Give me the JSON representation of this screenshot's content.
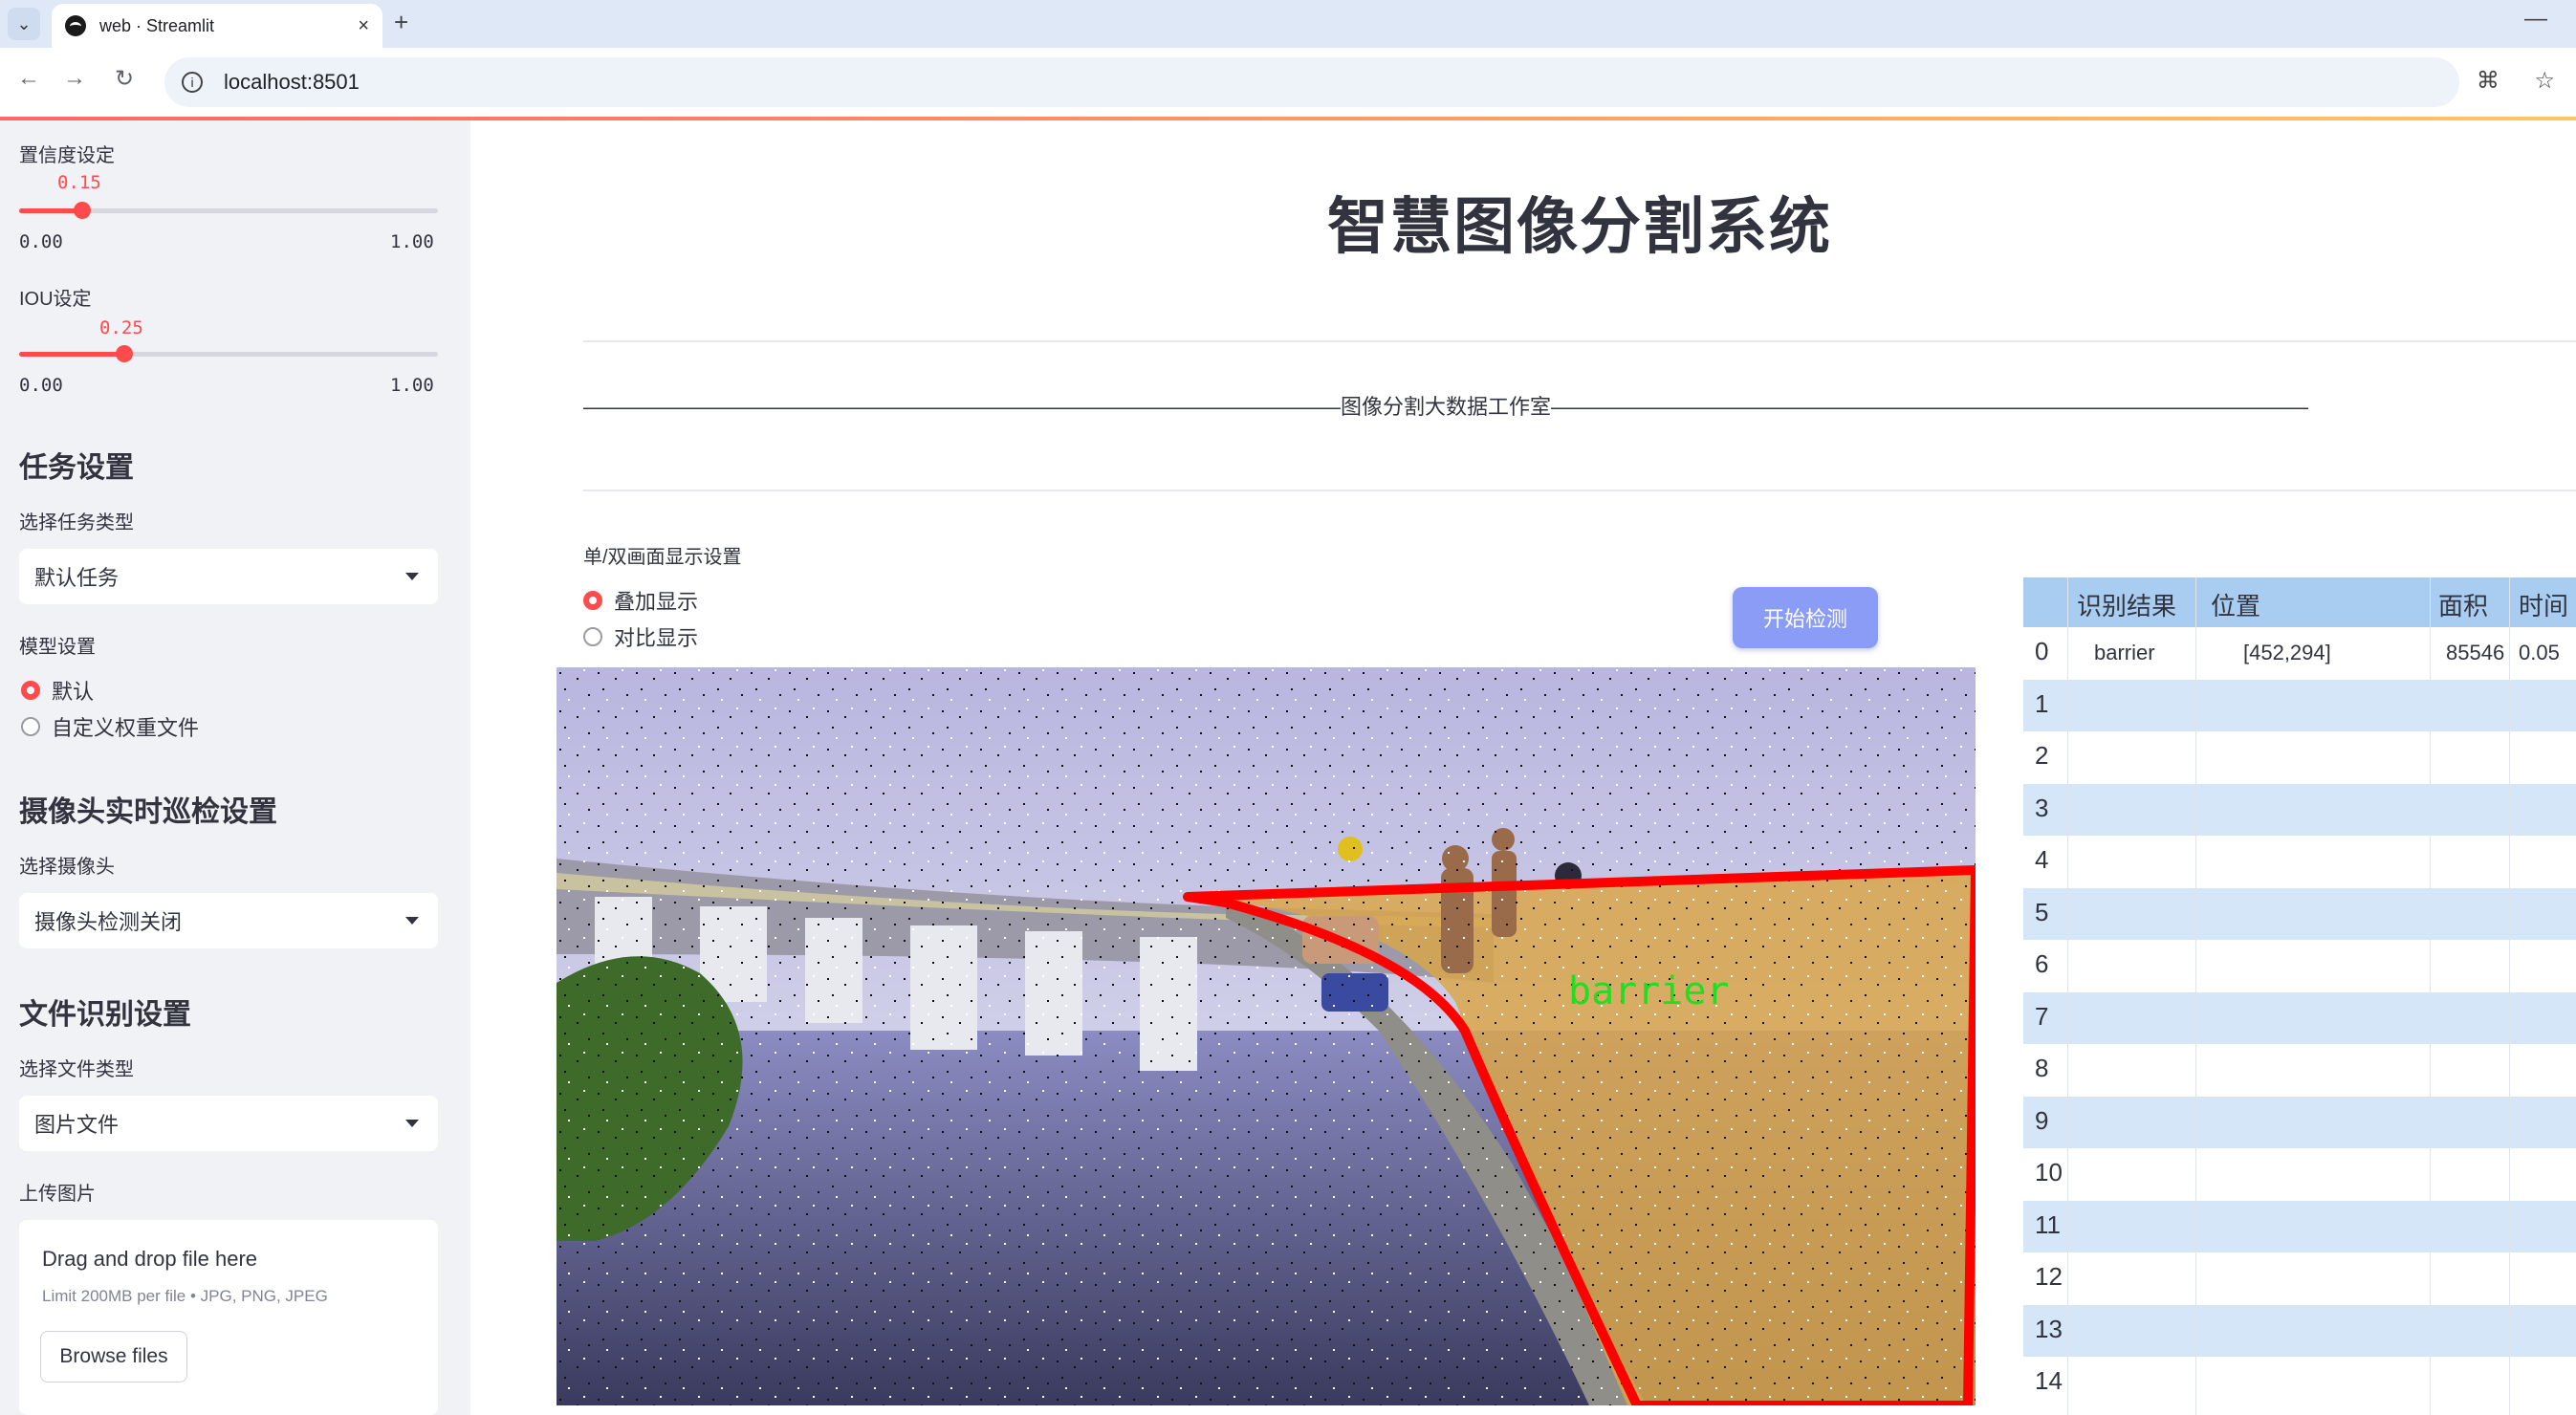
{
  "browser": {
    "tab_title": "web · Streamlit",
    "close_glyph": "×",
    "new_tab_glyph": "+",
    "minimize_glyph": "—",
    "url": "localhost:8501",
    "icons": [
      "tab-menu-icon",
      "back-icon",
      "forward-icon",
      "reload-icon",
      "site-info-icon",
      "translate-icon",
      "bookmark-star-icon"
    ]
  },
  "sidebar": {
    "confidence": {
      "label": "置信度设定",
      "value": "0.15",
      "min": "0.00",
      "max": "1.00",
      "fraction": 0.15
    },
    "iou": {
      "label": "IOU设定",
      "value": "0.25",
      "min": "0.00",
      "max": "1.00",
      "fraction": 0.25
    },
    "task": {
      "heading": "任务设置",
      "label": "选择任务类型",
      "selected": "默认任务"
    },
    "model": {
      "label": "模型设置",
      "options": [
        "默认",
        "自定义权重文件"
      ],
      "selected_index": 0
    },
    "camera": {
      "heading": "摄像头实时巡检设置",
      "label": "选择摄像头",
      "selected": "摄像头检测关闭"
    },
    "file": {
      "heading": "文件识别设置",
      "label": "选择文件类型",
      "selected": "图片文件"
    },
    "upload": {
      "label": "上传图片",
      "drop_text": "Drag and drop file here",
      "limit_text": "Limit 200MB per file • JPG, PNG, JPEG",
      "browse_label": "Browse files"
    }
  },
  "main": {
    "title": "智慧图像分割系统",
    "subtitle_line": "————————————————————————————————————图像分割大数据工作室————————————————————————————————————",
    "display_label": "单/双画面显示设置",
    "display_options": [
      "叠加显示",
      "对比显示"
    ],
    "display_selected_index": 0,
    "detect_button": "开始检测",
    "detection_label": "barrier"
  },
  "colors": {
    "accent": "#ff4b4b",
    "sidebar_bg": "#f0f2f6",
    "button": "#8a9cf5",
    "table_header": "#a9cdf0",
    "table_alt": "#d4e6f8",
    "mask_outline": "#ff0000",
    "label_green": "#22dd22"
  },
  "table": {
    "columns": [
      "识别结果",
      "位置",
      "面积",
      "时间"
    ],
    "rows": [
      {
        "idx": "0",
        "result": "barrier",
        "pos": "[452,294]",
        "area": "85546",
        "time": "0.05"
      },
      {
        "idx": "1",
        "result": "",
        "pos": "",
        "area": "",
        "time": ""
      },
      {
        "idx": "2",
        "result": "",
        "pos": "",
        "area": "",
        "time": ""
      },
      {
        "idx": "3",
        "result": "",
        "pos": "",
        "area": "",
        "time": ""
      },
      {
        "idx": "4",
        "result": "",
        "pos": "",
        "area": "",
        "time": ""
      },
      {
        "idx": "5",
        "result": "",
        "pos": "",
        "area": "",
        "time": ""
      },
      {
        "idx": "6",
        "result": "",
        "pos": "",
        "area": "",
        "time": ""
      },
      {
        "idx": "7",
        "result": "",
        "pos": "",
        "area": "",
        "time": ""
      },
      {
        "idx": "8",
        "result": "",
        "pos": "",
        "area": "",
        "time": ""
      },
      {
        "idx": "9",
        "result": "",
        "pos": "",
        "area": "",
        "time": ""
      },
      {
        "idx": "10",
        "result": "",
        "pos": "",
        "area": "",
        "time": ""
      },
      {
        "idx": "11",
        "result": "",
        "pos": "",
        "area": "",
        "time": ""
      },
      {
        "idx": "12",
        "result": "",
        "pos": "",
        "area": "",
        "time": ""
      },
      {
        "idx": "13",
        "result": "",
        "pos": "",
        "area": "",
        "time": ""
      },
      {
        "idx": "14",
        "result": "",
        "pos": "",
        "area": "",
        "time": ""
      }
    ]
  }
}
